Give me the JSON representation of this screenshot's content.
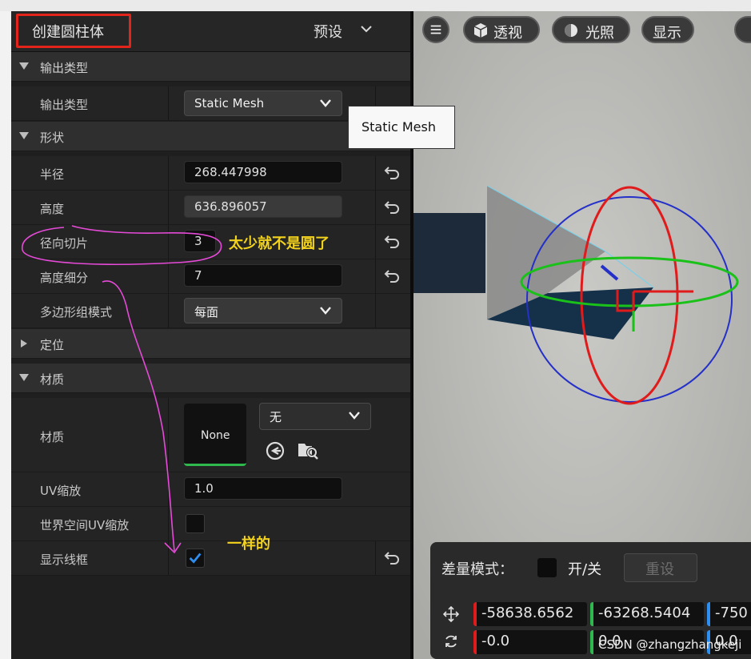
{
  "panel": {
    "title": "创建圆柱体",
    "preset_label": "预设",
    "sections": {
      "output_type": "输出类型",
      "shape": "形状",
      "position": "定位",
      "material": "材质"
    },
    "rows": {
      "output_type": {
        "label": "输出类型",
        "value": "Static Mesh"
      },
      "radius": {
        "label": "半径",
        "value": "268.447998"
      },
      "height": {
        "label": "高度",
        "value": "636.896057"
      },
      "radial_slices": {
        "label": "径向切片",
        "value": "3"
      },
      "height_subdiv": {
        "label": "高度细分",
        "value": "7"
      },
      "polygroup_mode": {
        "label": "多边形组模式",
        "value": "每面"
      },
      "material": {
        "label": "材质",
        "thumb": "None",
        "dropdown": "无"
      },
      "uv_scale": {
        "label": "UV缩放",
        "value": "1.0"
      },
      "world_uv": {
        "label": "世界空间UV缩放",
        "checked": false
      },
      "show_wire": {
        "label": "显示线框",
        "checked": true
      }
    },
    "tooltip": "Static Mesh"
  },
  "annotations": {
    "too_few": "太少就不是圆了",
    "same": "一样的",
    "highlight_color": "#e3241b",
    "magenta": "#e64ad8",
    "yellow": "#f2d21c"
  },
  "viewport": {
    "buttons": {
      "menu": "menu-icon",
      "perspective": "透视",
      "lighting": "光照",
      "show": "显示"
    },
    "delta_mode_label": "差量模式：",
    "onoff_label": "开/关",
    "reset_label": "重设",
    "location": [
      "-58638.6562",
      "-63268.5404",
      "-750"
    ],
    "rotation": [
      "-0.0",
      "0.0",
      "0.0"
    ]
  },
  "watermark": "CSDN @zhangzhangkeji"
}
